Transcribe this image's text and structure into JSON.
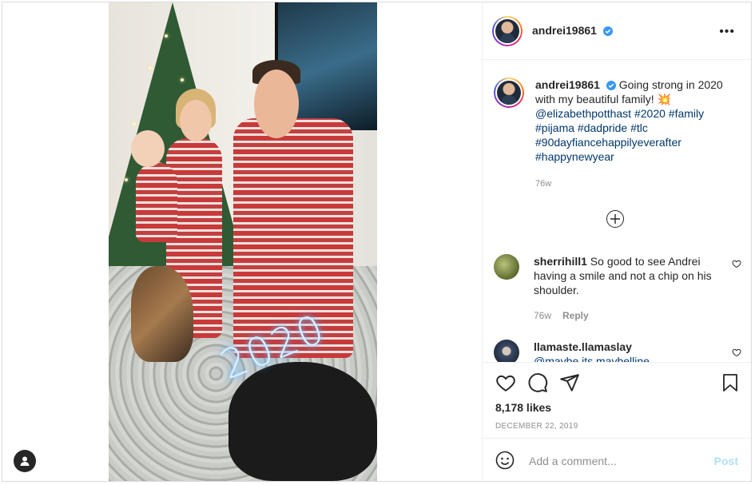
{
  "post": {
    "username": "andrei19861",
    "more_label": "•••",
    "caption": {
      "username": "andrei19861",
      "text_1": " Going strong in 2020 with my beautiful family! 💥",
      "tags_line": [
        "@elizabethpotthast",
        "#2020",
        "#family",
        "#pijama",
        "#dadpride",
        "#tlc",
        "#90dayfiancehappilyeverafter",
        "#happynewyear"
      ],
      "time": "76w"
    },
    "photo_overlay_text": "2020",
    "load_more_icon": "plus-circle-icon",
    "comments": [
      {
        "username": "sherrihill1",
        "text": " So good to see Andrei having a smile and not a chip on his shoulder.",
        "time": "76w",
        "reply_label": "Reply"
      },
      {
        "username": "llamaste.llamaslay",
        "text": "@maybe its maybelline"
      }
    ],
    "likes": "8,178 likes",
    "date": "DECEMBER 22, 2019",
    "comment_placeholder": "Add a comment...",
    "post_label": "Post"
  },
  "colors": {
    "link": "#00376b",
    "muted": "#8e8e8e",
    "post_disabled": "#b2dffc",
    "verified": "#3897f0"
  }
}
